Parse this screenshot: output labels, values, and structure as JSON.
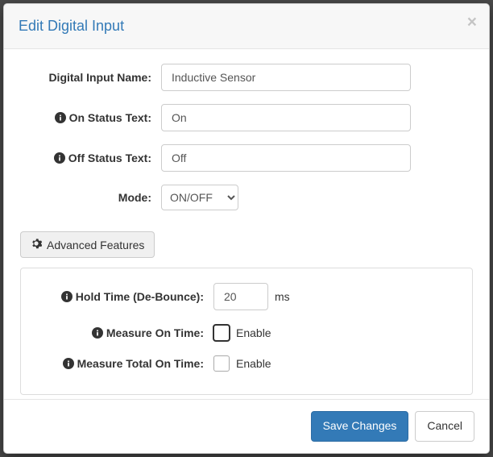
{
  "modal": {
    "title": "Edit Digital Input"
  },
  "form": {
    "digital_input_name": {
      "label": "Digital Input Name:",
      "value": "Inductive Sensor"
    },
    "on_status_text": {
      "label": "On Status Text:",
      "value": "On"
    },
    "off_status_text": {
      "label": "Off Status Text:",
      "value": "Off"
    },
    "mode": {
      "label": "Mode:",
      "value": "ON/OFF"
    }
  },
  "advanced": {
    "button_label": "Advanced Features",
    "hold_time": {
      "label": "Hold Time (De-Bounce):",
      "value": "20",
      "unit": "ms"
    },
    "measure_on_time": {
      "label": "Measure On Time:",
      "enable_label": "Enable",
      "checked": false
    },
    "measure_total_on_time": {
      "label": "Measure Total On Time:",
      "enable_label": "Enable",
      "checked": false
    }
  },
  "footer": {
    "save_label": "Save Changes",
    "cancel_label": "Cancel"
  }
}
